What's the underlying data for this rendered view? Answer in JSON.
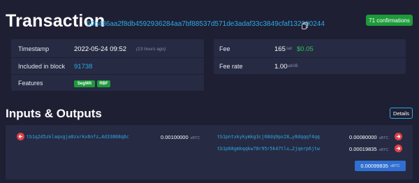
{
  "header": {
    "title": "Transaction",
    "txid": "50b486aa2f8db4592936284aa7bf88537d571de3adaf33c3849cfaf132990244",
    "confirmations": "71 confirmations"
  },
  "details": {
    "timestamp_label": "Timestamp",
    "timestamp_value": "2022-05-24 09:52",
    "timestamp_ago": "(13 hours ago)",
    "block_label": "Included in block",
    "block_value": "91738",
    "features_label": "Features",
    "features": [
      "SegWit",
      "RBF"
    ],
    "fee_label": "Fee",
    "fee_value": "165",
    "fee_unit": "sat",
    "fee_usd": "$0.05",
    "fee_rate_label": "Fee rate",
    "fee_rate_value": "1.00",
    "fee_rate_unit": "sat/vB"
  },
  "io": {
    "title": "Inputs & Outputs",
    "details_button": "Details",
    "unit": "sBTC",
    "inputs": [
      {
        "address": "tb1q2d5zklaqxgja8zxrkx6nfz…4d33868q6c",
        "amount": "0.00100000"
      }
    ],
    "outputs": [
      {
        "address": "tb1pntxkykymkg3cj68dq9px28…y8dqqqf4qq",
        "amount": "0.00080000"
      },
      {
        "address": "tb1p68gmkqqkw78r95r5k47tlx…2jqerp6jtw",
        "amount": "0.00019835"
      }
    ],
    "total": "0.00099835",
    "colors": {
      "accent": "#2fa8e6",
      "green": "#1d9a3a",
      "red": "#e03f4a",
      "total": "#2f6fd1"
    }
  }
}
